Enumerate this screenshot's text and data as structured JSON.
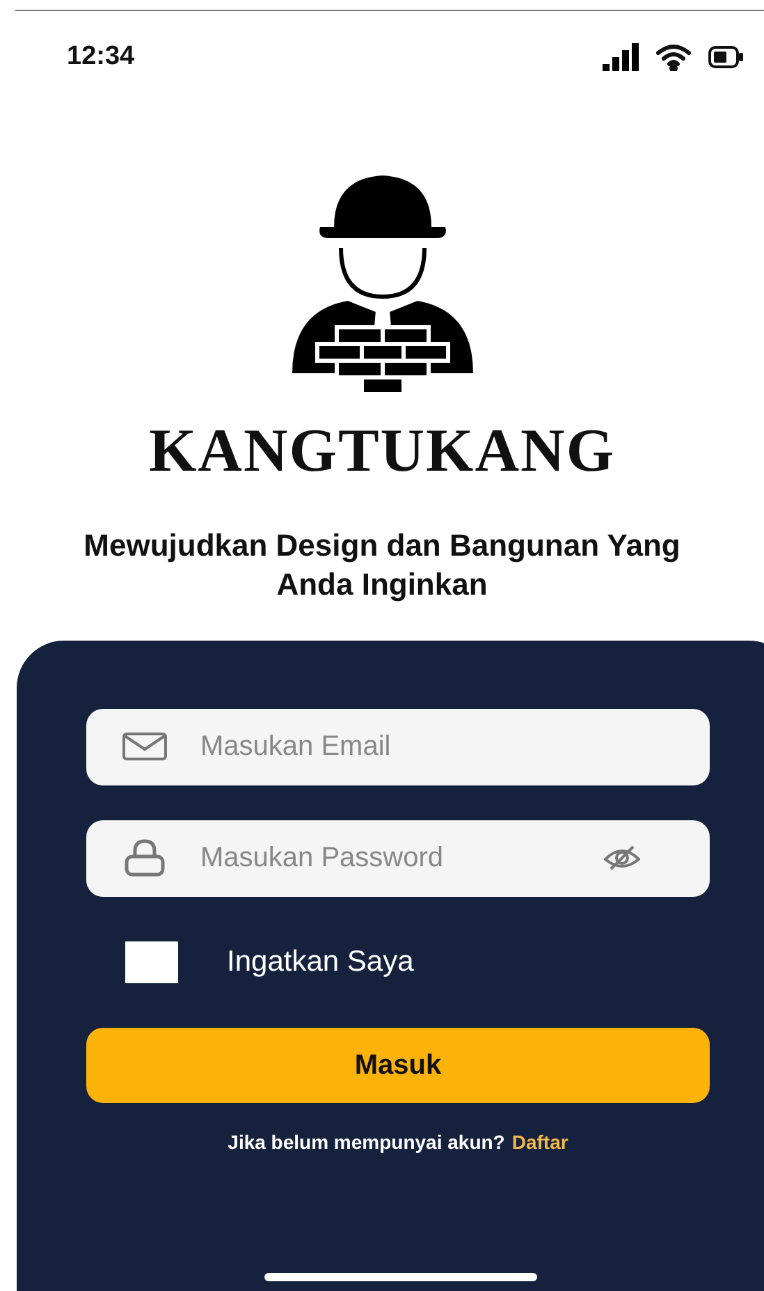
{
  "status_bar": {
    "time": "12:34"
  },
  "brand": {
    "name": "KANGTUKANG",
    "tagline": "Mewujudkan Design dan Bangunan Yang Anda Inginkan"
  },
  "form": {
    "email": {
      "placeholder": "Masukan Email"
    },
    "password": {
      "placeholder": "Masukan Password"
    },
    "remember": {
      "label": "Ingatkan Saya",
      "checked": false
    },
    "submit": "Masuk",
    "signup_prompt": "Jika belum mempunyai akun?",
    "signup_link": "Daftar"
  }
}
